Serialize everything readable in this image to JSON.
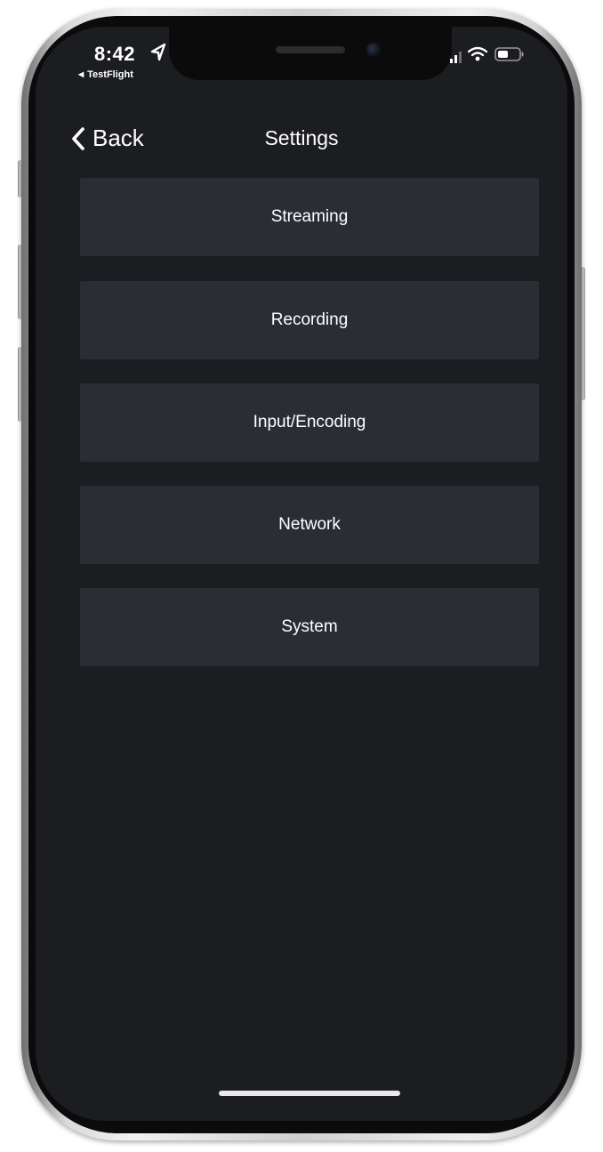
{
  "status_bar": {
    "time": "8:42",
    "location_icon": "location-arrow-icon",
    "back_app_label": "TestFlight",
    "signal_icon": "cellular-signal-icon",
    "wifi_icon": "wifi-icon",
    "battery_icon": "battery-icon"
  },
  "nav": {
    "back_label": "Back",
    "back_icon": "chevron-left-icon",
    "title": "Settings"
  },
  "menu": {
    "items": [
      {
        "label": "Streaming"
      },
      {
        "label": "Recording"
      },
      {
        "label": "Input/Encoding"
      },
      {
        "label": "Network"
      },
      {
        "label": "System"
      }
    ]
  },
  "colors": {
    "screen_background": "#1b1d20",
    "menu_item_background": "#2a2e34",
    "text": "#ffffff"
  }
}
